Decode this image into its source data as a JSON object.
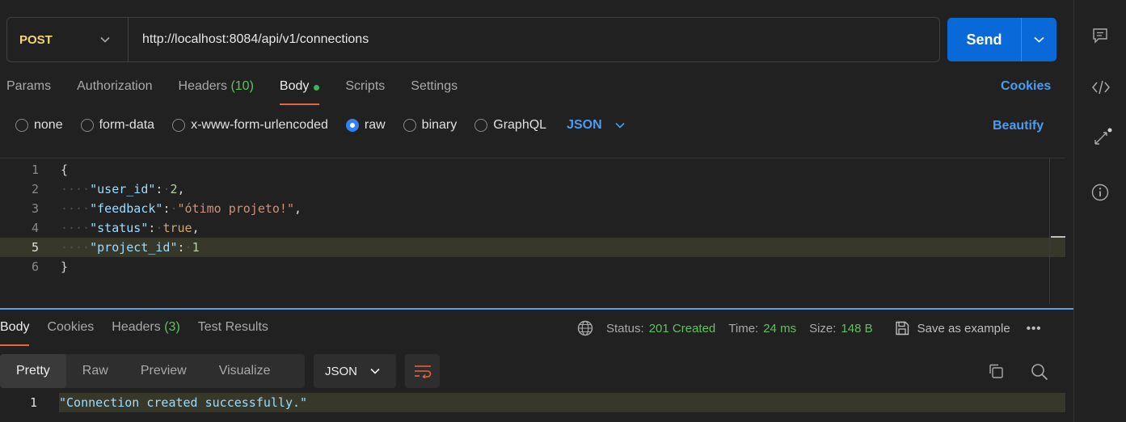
{
  "request": {
    "method": "POST",
    "url": "http://localhost:8084/api/v1/connections",
    "send_label": "Send"
  },
  "req_tabs": {
    "params": "Params",
    "authorization": "Authorization",
    "headers": "Headers",
    "headers_count": "(10)",
    "body": "Body",
    "scripts": "Scripts",
    "settings": "Settings",
    "cookies": "Cookies"
  },
  "body_types": {
    "none": "none",
    "form_data": "form-data",
    "urlencoded": "x-www-form-urlencoded",
    "raw": "raw",
    "binary": "binary",
    "graphql": "GraphQL",
    "selected": "raw",
    "format": "JSON",
    "beautify": "Beautify"
  },
  "editor": {
    "line_numbers": [
      "1",
      "2",
      "3",
      "4",
      "5",
      "6"
    ],
    "open_brace": "{",
    "close_brace": "}",
    "k1": "\"user_id\"",
    "v1": "2",
    "k2": "\"feedback\"",
    "v2": "\"ótimo projeto!\"",
    "k3": "\"status\"",
    "v3": "true",
    "k4": "\"project_id\"",
    "v4": "1",
    "current_line": 5
  },
  "response": {
    "tabs": {
      "body": "Body",
      "cookies": "Cookies",
      "headers": "Headers",
      "headers_count": "(3)",
      "test_results": "Test Results"
    },
    "status_label": "Status:",
    "status_value": "201 Created",
    "time_label": "Time:",
    "time_value": "24 ms",
    "size_label": "Size:",
    "size_value": "148 B",
    "save_example": "Save as example",
    "more": "•••",
    "views": {
      "pretty": "Pretty",
      "raw": "Raw",
      "preview": "Preview",
      "visualize": "Visualize"
    },
    "format": "JSON",
    "body_line_number": "1",
    "body_text": "\"Connection created successfully.\""
  },
  "colors": {
    "accent": "#0a69d8",
    "link": "#4a9df0",
    "success": "#5ec25e",
    "method": "#f5d76e",
    "active_tab": "#e4653e"
  }
}
